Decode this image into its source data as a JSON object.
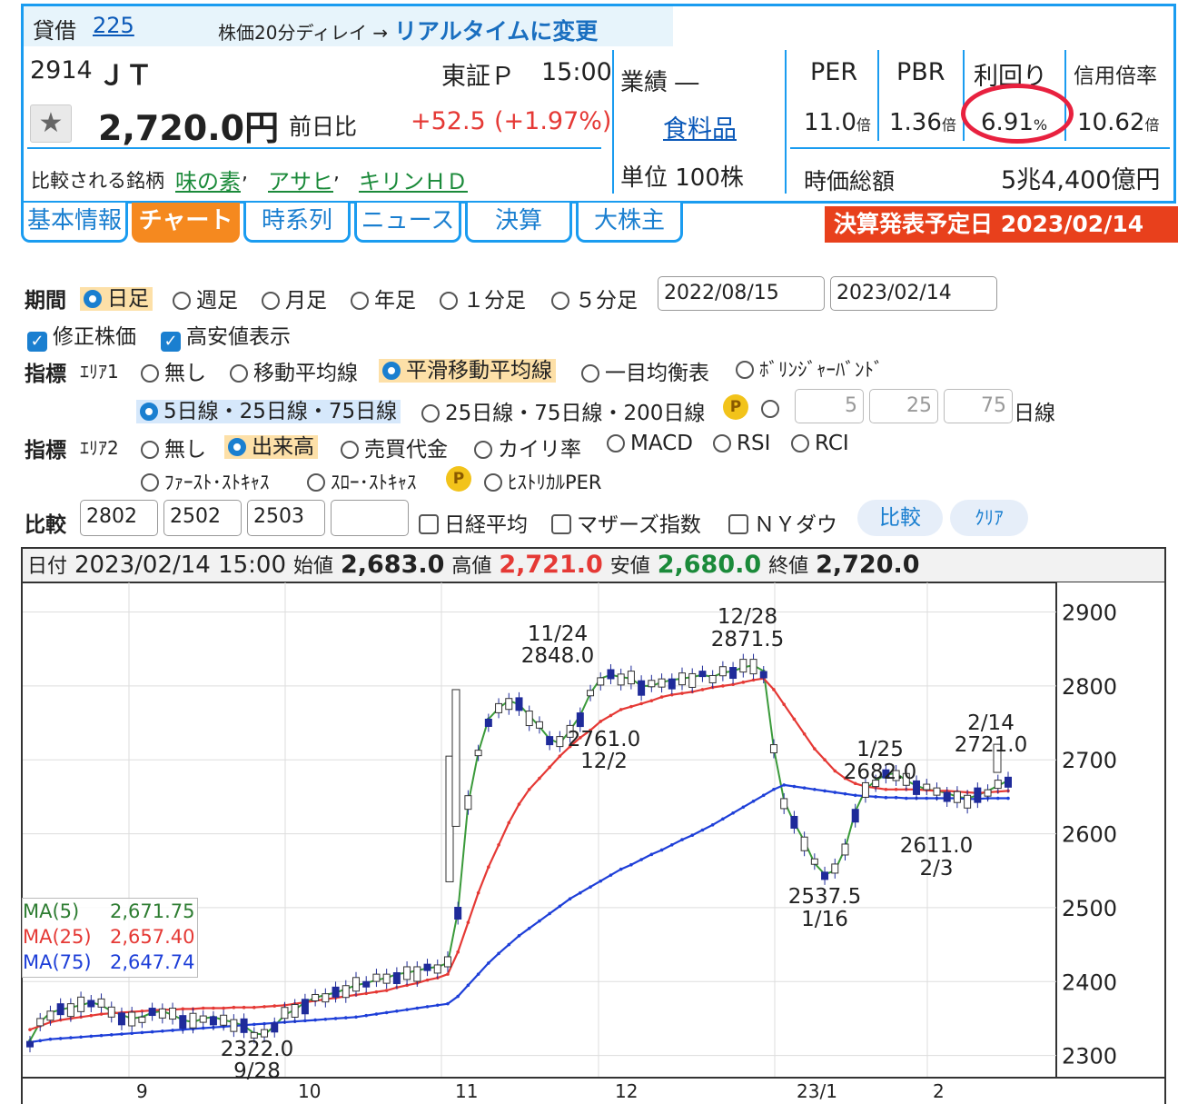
{
  "header": {
    "badge": "貸借",
    "badge_number": "225",
    "delay_note": "株価20分ディレイ →",
    "realtime_link": "リアルタイムに変更",
    "code": "2914",
    "name": "ＪＴ",
    "market": "東証Ｐ",
    "time": "15:00",
    "price": "2,720.0円",
    "change_label": "前日比",
    "change": "+52.5",
    "change_pct": "(+1.97%)",
    "performance": "業績 ―",
    "sector": "食料品",
    "unit": "単位 100株",
    "compare_label": "比較される銘柄",
    "compare_stocks": [
      "味の素",
      "アサヒ",
      "キリンＨＤ"
    ]
  },
  "metrics": {
    "per_label": "PER",
    "per_value": "11.0",
    "per_unit": "倍",
    "pbr_label": "PBR",
    "pbr_value": "1.36",
    "pbr_unit": "倍",
    "yield_label": "利回り",
    "yield_value": "6.91",
    "yield_unit": "%",
    "margin_label": "信用倍率",
    "margin_value": "10.62",
    "margin_unit": "倍",
    "mcap_label": "時価総額",
    "mcap_value": "5兆4,400億円"
  },
  "tabs": [
    "基本情報",
    "チャート",
    "時系列",
    "ニュース",
    "決算",
    "大株主"
  ],
  "earnings_banner": "決算発表予定日 2023/02/14",
  "controls": {
    "period_label": "期間",
    "period_options": [
      "日足",
      "週足",
      "月足",
      "年足",
      "１分足",
      "５分足"
    ],
    "date_from": "2022/08/15",
    "date_to": "2023/02/14",
    "adjusted_label": "修正株価",
    "highlow_label": "高安値表示",
    "ind_label": "指標",
    "area1_label": "ｴﾘｱ1",
    "area1_options": [
      "無し",
      "移動平均線",
      "平滑移動平均線",
      "一目均衡表",
      "ﾎﾞﾘﾝｼﾞｬｰﾊﾞﾝﾄﾞ"
    ],
    "ma_options": [
      "5日線・25日線・75日線",
      "25日線・75日線・200日線"
    ],
    "ma_custom": [
      "5",
      "25",
      "75"
    ],
    "ma_suffix": "日線",
    "area2_label": "ｴﾘｱ2",
    "area2_options": [
      "無し",
      "出来高",
      "売買代金",
      "カイリ率",
      "MACD",
      "RSI",
      "RCI"
    ],
    "area2_options_row2": [
      "ﾌｧｰｽﾄ･ｽﾄｷｬｽ",
      "ｽﾛｰ･ｽﾄｷｬｽ",
      "ﾋｽﾄﾘｶﾙPER"
    ],
    "p_badge": "P",
    "compare_label": "比較",
    "compare_codes": [
      "2802",
      "2502",
      "2503",
      ""
    ],
    "compare_indices": [
      "日経平均",
      "マザーズ指数",
      "ＮＹダウ"
    ],
    "compare_button": "比較",
    "clear_button": "ｸﾘｱ"
  },
  "ohlc_bar": {
    "date_label": "日付",
    "date": "2023/02/14 15:00",
    "open_label": "始値",
    "open": "2,683.0",
    "high_label": "高値",
    "high": "2,721.0",
    "low_label": "安値",
    "low": "2,680.0",
    "close_label": "終値",
    "close": "2,720.0"
  },
  "chart_data": {
    "type": "line",
    "ylim": [
      2270,
      2940
    ],
    "y_ticks": [
      2300,
      2400,
      2500,
      2600,
      2700,
      2800,
      2900
    ],
    "x_labels": [
      "9",
      "10",
      "11",
      "12",
      "23/1",
      "2"
    ],
    "legend": [
      {
        "name": "MA(5)",
        "value": "2,671.75",
        "color": "#2e7d32"
      },
      {
        "name": "MA(25)",
        "value": "2,657.40",
        "color": "#e53935"
      },
      {
        "name": "MA(75)",
        "value": "2,647.74",
        "color": "#1e3fd8"
      }
    ],
    "series": [
      {
        "name": "MA(5)",
        "color": "#3a9a3a",
        "values": [
          2320,
          2345,
          2358,
          2362,
          2365,
          2368,
          2372,
          2368,
          2360,
          2355,
          2350,
          2352,
          2358,
          2360,
          2355,
          2348,
          2345,
          2350,
          2352,
          2348,
          2345,
          2340,
          2330,
          2328,
          2340,
          2355,
          2362,
          2372,
          2378,
          2382,
          2385,
          2390,
          2395,
          2398,
          2402,
          2405,
          2410,
          2412,
          2415,
          2418,
          2420,
          2425,
          2495,
          2640,
          2710,
          2755,
          2770,
          2780,
          2775,
          2760,
          2745,
          2728,
          2722,
          2740,
          2760,
          2790,
          2810,
          2815,
          2812,
          2810,
          2800,
          2800,
          2805,
          2808,
          2810,
          2812,
          2815,
          2812,
          2818,
          2820,
          2825,
          2828,
          2820,
          2715,
          2645,
          2615,
          2590,
          2560,
          2545,
          2550,
          2580,
          2630,
          2660,
          2672,
          2680,
          2682,
          2672,
          2665,
          2660,
          2658,
          2655,
          2650,
          2648,
          2652,
          2658,
          2665,
          2672
        ]
      },
      {
        "name": "MA(25)",
        "color": "#e53935",
        "values": [
          2335,
          2340,
          2345,
          2348,
          2350,
          2352,
          2354,
          2356,
          2357,
          2358,
          2359,
          2360,
          2361,
          2362,
          2362,
          2363,
          2363,
          2364,
          2364,
          2364,
          2365,
          2365,
          2365,
          2366,
          2367,
          2368,
          2370,
          2372,
          2374,
          2376,
          2378,
          2380,
          2382,
          2384,
          2386,
          2388,
          2392,
          2395,
          2398,
          2402,
          2405,
          2410,
          2440,
          2480,
          2520,
          2555,
          2585,
          2615,
          2640,
          2660,
          2675,
          2690,
          2705,
          2718,
          2730,
          2740,
          2752,
          2760,
          2768,
          2772,
          2776,
          2780,
          2785,
          2788,
          2790,
          2792,
          2795,
          2798,
          2800,
          2802,
          2805,
          2808,
          2810,
          2795,
          2775,
          2755,
          2735,
          2715,
          2700,
          2685,
          2675,
          2668,
          2664,
          2662,
          2660,
          2660,
          2660,
          2660,
          2659,
          2658,
          2658,
          2657,
          2656,
          2655,
          2656,
          2657,
          2658
        ]
      },
      {
        "name": "MA(75)",
        "color": "#1e3fd8",
        "values": [
          2318,
          2320,
          2322,
          2323,
          2324,
          2325,
          2326,
          2327,
          2328,
          2329,
          2330,
          2331,
          2332,
          2333,
          2334,
          2335,
          2336,
          2337,
          2338,
          2339,
          2340,
          2341,
          2342,
          2343,
          2344,
          2345,
          2346,
          2347,
          2348,
          2349,
          2350,
          2351,
          2352,
          2354,
          2356,
          2358,
          2360,
          2362,
          2364,
          2366,
          2368,
          2370,
          2380,
          2395,
          2410,
          2425,
          2438,
          2450,
          2462,
          2472,
          2482,
          2492,
          2502,
          2512,
          2520,
          2528,
          2536,
          2544,
          2552,
          2558,
          2565,
          2572,
          2578,
          2585,
          2592,
          2598,
          2605,
          2612,
          2620,
          2628,
          2636,
          2644,
          2652,
          2660,
          2666,
          2664,
          2662,
          2660,
          2658,
          2656,
          2654,
          2652,
          2651,
          2650,
          2649,
          2649,
          2648,
          2648,
          2648,
          2648,
          2648,
          2648,
          2647,
          2647,
          2648,
          2648,
          2648
        ]
      }
    ],
    "annotations": [
      {
        "date": "9/28",
        "value": "2322.0",
        "type": "low"
      },
      {
        "date": "11/24",
        "value": "2848.0",
        "type": "high"
      },
      {
        "date": "12/2",
        "value": "2761.0",
        "type": "low"
      },
      {
        "date": "12/28",
        "value": "2871.5",
        "type": "high"
      },
      {
        "date": "1/16",
        "value": "2537.5",
        "type": "low"
      },
      {
        "date": "1/25",
        "value": "2682.0",
        "type": "high"
      },
      {
        "date": "2/3",
        "value": "2611.0",
        "type": "low"
      },
      {
        "date": "2/14",
        "value": "2721.0",
        "type": "high"
      }
    ]
  }
}
